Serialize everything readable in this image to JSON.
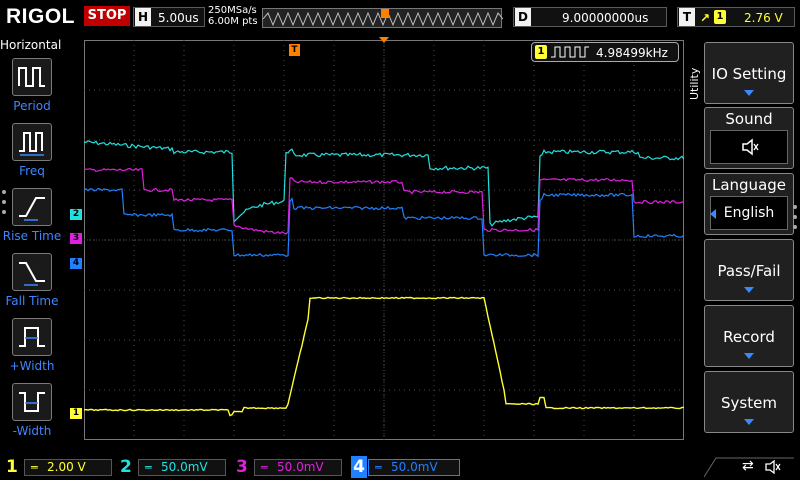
{
  "header": {
    "brand": "RIGOL",
    "run_state": "STOP",
    "timebase_tag": "H",
    "timebase_value": "5.00us",
    "sample_rate": "250MSa/s",
    "memory_depth": "6.00M pts",
    "delay_tag": "D",
    "delay_value": "9.00000000us",
    "trigger_tag": "T",
    "trigger_source": "1",
    "trigger_level": "2.76 V"
  },
  "left_panel": {
    "title": "Horizontal",
    "items": [
      {
        "label": "Period",
        "icon": "period-measure-icon"
      },
      {
        "label": "Freq",
        "icon": "frequency-measure-icon"
      },
      {
        "label": "Rise Time",
        "icon": "rise-time-icon"
      },
      {
        "label": "Fall Time",
        "icon": "fall-time-icon"
      },
      {
        "label": "+Width",
        "icon": "positive-width-icon"
      },
      {
        "label": "-Width",
        "icon": "negative-width-icon"
      }
    ]
  },
  "screen": {
    "freq_channel": "1",
    "frequency": "4.98499kHz",
    "trigger_marker": "T",
    "channel_markers": [
      "1",
      "2",
      "3",
      "4"
    ]
  },
  "right_menu": {
    "title": "Utility",
    "items": [
      {
        "label": "IO Setting"
      },
      {
        "label": "Sound",
        "value": "speaker-muted-icon"
      },
      {
        "label": "Language",
        "value": "English"
      },
      {
        "label": "Pass/Fail"
      },
      {
        "label": "Record"
      },
      {
        "label": "System"
      }
    ]
  },
  "channels": [
    {
      "number": "1",
      "scale": "2.00 V",
      "color": "#ffff33"
    },
    {
      "number": "2",
      "scale": "50.0mV",
      "color": "#22e0e0"
    },
    {
      "number": "3",
      "scale": "50.0mV",
      "color": "#e020e0"
    },
    {
      "number": "4",
      "scale": "50.0mV",
      "color": "#2080ff"
    }
  ],
  "colors": {
    "trigger": "#ff8000",
    "accent": "#3e86ff",
    "grid": "#3a3a3a"
  }
}
